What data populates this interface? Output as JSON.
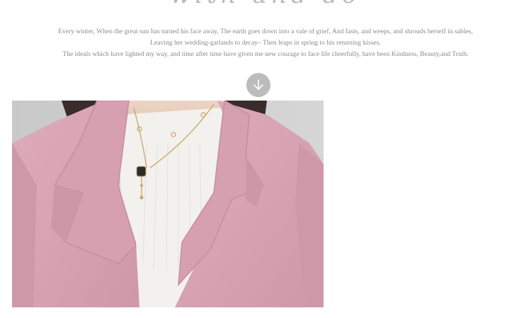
{
  "heading": {
    "script_text": "with and do"
  },
  "poem": {
    "lines": [
      "Every winter, When the great sun has turned his face away, The earth goes down into a vale of grief, And fasts, and weeps, and shrouds herself in sables,",
      "Leaving her wedding-garlands to decay– Then leaps in spring to his returning kisses.",
      "The ideals which have lighted my way, and time after time have given me new courage to face life cheerfully, have been Kindness, Beauty,and Truth."
    ]
  },
  "icons": {
    "scroll": "arrow-down-circle-icon"
  },
  "colors": {
    "coat_pink": "#d9a4b4",
    "sweater_white": "#f3f1ee",
    "background_gray": "#cfcfd0",
    "text_gray": "#8a8a8a",
    "arrow_circle": "#bcbcbc"
  }
}
